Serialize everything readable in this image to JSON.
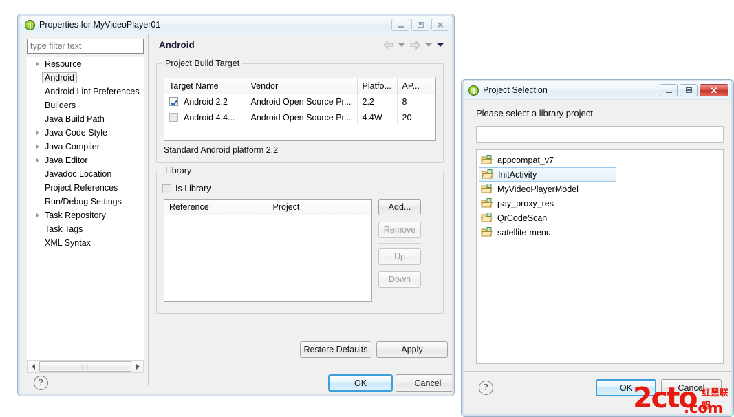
{
  "properties_dialog": {
    "title": "Properties for MyVideoPlayer01",
    "icon": "eclipse-icon",
    "window_buttons": {
      "minimize": "minimize-icon",
      "maximize": "maximize-icon",
      "close": "close-icon"
    },
    "filter": {
      "placeholder": "type filter text",
      "value": ""
    },
    "tree": [
      {
        "label": "Resource",
        "expandable": true,
        "selected": false
      },
      {
        "label": "Android",
        "expandable": false,
        "selected": true
      },
      {
        "label": "Android Lint Preferences",
        "expandable": false,
        "selected": false
      },
      {
        "label": "Builders",
        "expandable": false,
        "selected": false
      },
      {
        "label": "Java Build Path",
        "expandable": false,
        "selected": false
      },
      {
        "label": "Java Code Style",
        "expandable": true,
        "selected": false
      },
      {
        "label": "Java Compiler",
        "expandable": true,
        "selected": false
      },
      {
        "label": "Java Editor",
        "expandable": true,
        "selected": false
      },
      {
        "label": "Javadoc Location",
        "expandable": false,
        "selected": false
      },
      {
        "label": "Project References",
        "expandable": false,
        "selected": false
      },
      {
        "label": "Run/Debug Settings",
        "expandable": false,
        "selected": false
      },
      {
        "label": "Task Repository",
        "expandable": true,
        "selected": false
      },
      {
        "label": "Task Tags",
        "expandable": false,
        "selected": false
      },
      {
        "label": "XML Syntax",
        "expandable": false,
        "selected": false
      }
    ],
    "pane_title": "Android",
    "nav": {
      "back": "back-arrow-icon",
      "forward": "forward-arrow-icon",
      "menu": "chevron-down-icon"
    },
    "build_target": {
      "legend": "Project Build Target",
      "columns": [
        "Target Name",
        "Vendor",
        "Platfo...",
        "AP..."
      ],
      "rows": [
        {
          "checked": true,
          "name": "Android 2.2",
          "vendor": "Android Open Source Pr...",
          "platform": "2.2",
          "api": "8"
        },
        {
          "checked": false,
          "name": "Android 4.4...",
          "vendor": "Android Open Source Pr...",
          "platform": "4.4W",
          "api": "20"
        }
      ],
      "status": "Standard Android platform 2.2"
    },
    "library": {
      "legend": "Library",
      "is_library_label": "Is Library",
      "is_library_checked": false,
      "columns": [
        "Reference",
        "Project"
      ],
      "rows": [],
      "buttons": [
        {
          "label": "Add...",
          "disabled": false
        },
        {
          "label": "Remove",
          "disabled": true
        },
        {
          "label": "Up",
          "disabled": true
        },
        {
          "label": "Down",
          "disabled": true
        }
      ]
    },
    "restore_defaults_label": "Restore Defaults",
    "apply_label": "Apply",
    "help_label": "?",
    "ok_label": "OK",
    "cancel_label": "Cancel"
  },
  "project_selection_dialog": {
    "title": "Project Selection",
    "icon": "eclipse-icon",
    "prompt": "Please select a library project",
    "filter_value": "",
    "projects": [
      {
        "label": "appcompat_v7",
        "selected": false
      },
      {
        "label": "InitActivity",
        "selected": true
      },
      {
        "label": "MyVideoPlayerModel",
        "selected": false
      },
      {
        "label": "pay_proxy_res",
        "selected": false
      },
      {
        "label": "QrCodeScan",
        "selected": false
      },
      {
        "label": "satellite-menu",
        "selected": false
      }
    ],
    "help_label": "?",
    "ok_label": "OK",
    "cancel_label": "Cancel"
  },
  "watermark": {
    "main": "2cto",
    "suffix": ".com",
    "chinese": "红黑联盟",
    "color": "#e8190f"
  }
}
